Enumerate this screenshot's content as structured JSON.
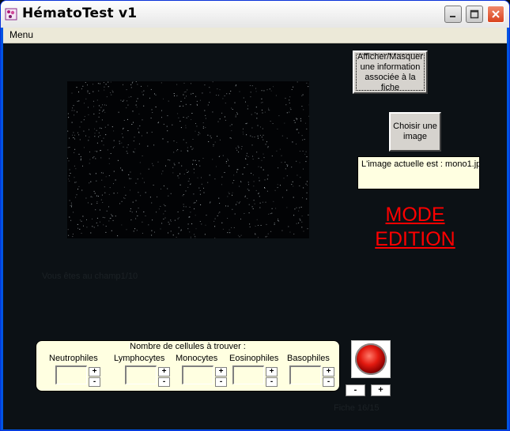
{
  "window": {
    "title": "HématoTest v1",
    "icons": {
      "app": "microscope-app-icon",
      "minimize": "minimize-icon",
      "maximize": "maximize-icon",
      "close": "close-icon"
    }
  },
  "menu": {
    "items": [
      "Menu"
    ]
  },
  "buttons": {
    "info": "Afficher/Masquer une information associée à la fiche",
    "choose": "Choisir une image"
  },
  "current_image": "L'image actuelle est : mono1.jp",
  "mode": "MODE EDITION",
  "field_status": "Vous êtes au champ1/10",
  "counter": {
    "title": "Nombre de cellules à trouver  :",
    "cells": [
      {
        "label": "Neutrophiles",
        "value": ""
      },
      {
        "label": "Lymphocytes",
        "value": ""
      },
      {
        "label": "Monocytes",
        "value": ""
      },
      {
        "label": "Eosinophiles",
        "value": ""
      },
      {
        "label": "Basophiles",
        "value": ""
      }
    ],
    "plus": "+",
    "minus": "-"
  },
  "record_icon": "record-icon",
  "nav": {
    "prev": "-",
    "next": "+"
  },
  "fiche_status": "Fiche 16/15",
  "colors": {
    "mode_text": "#ff0000",
    "panel_bg": "#ffffe1",
    "client_bg": "#0c1115"
  }
}
